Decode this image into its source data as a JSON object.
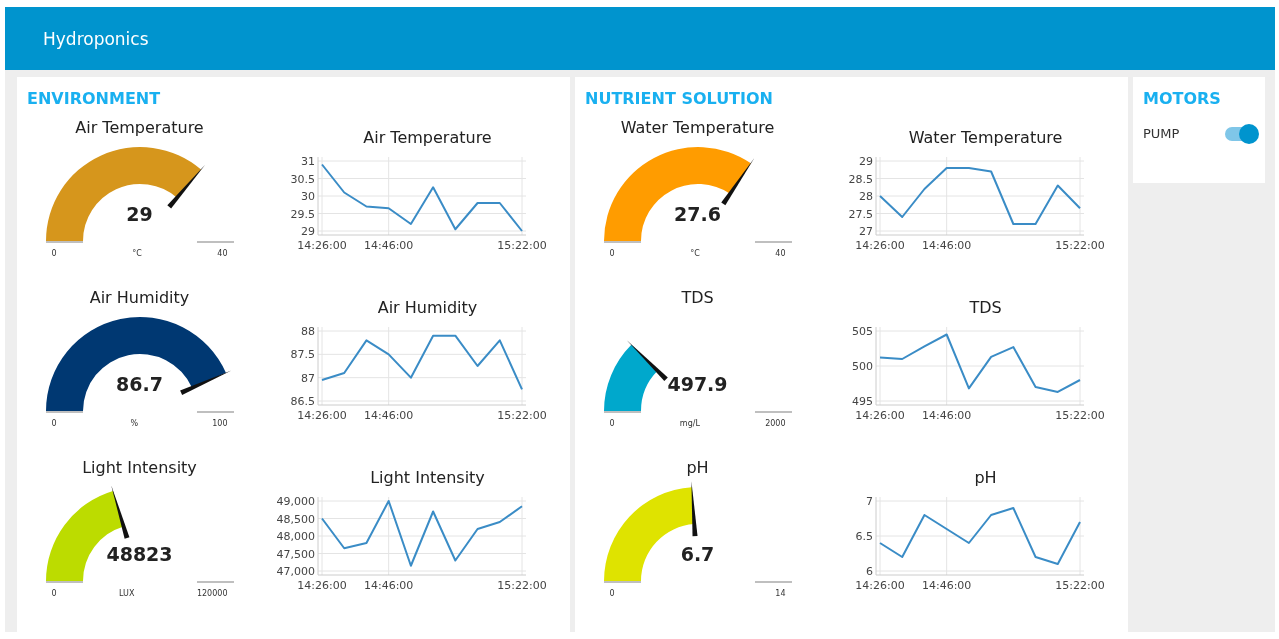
{
  "header": {
    "title": "Hydroponics"
  },
  "groups": [
    {
      "title": "ENVIRONMENT",
      "widgets": [
        {
          "gauge": {
            "title": "Air Temperature",
            "value": "29",
            "unit": "°C",
            "min": "0",
            "max": "40",
            "level": 0.725,
            "color": "#d6961c"
          },
          "chart_data": {
            "type": "line",
            "title": "Air Temperature",
            "grid": true,
            "categories": [
              "14:26:00",
              null,
              null,
              "14:46:00",
              null,
              null,
              null,
              null,
              null,
              "15:22:00"
            ],
            "series": [
              {
                "color": "#3a8cc6",
                "values": [
                  30.9,
                  30.1,
                  29.7,
                  29.65,
                  29.2,
                  30.25,
                  29.05,
                  29.8,
                  29.8,
                  29.0
                ]
              }
            ],
            "ylim": [
              29,
              31
            ],
            "yticks": [
              29,
              29.5,
              30,
              30.5,
              31
            ]
          }
        },
        {
          "gauge": {
            "title": "Air Humidity",
            "value": "86.7",
            "unit": "%",
            "min": "0",
            "max": "100",
            "level": 0.867,
            "color": "#003872"
          },
          "chart_data": {
            "type": "line",
            "title": "Air Humidity",
            "grid": true,
            "categories": [
              "14:26:00",
              null,
              null,
              "14:46:00",
              null,
              null,
              null,
              null,
              null,
              "15:22:00"
            ],
            "series": [
              {
                "color": "#3a8cc6",
                "values": [
                  86.95,
                  87.1,
                  87.8,
                  87.5,
                  87.0,
                  87.9,
                  87.9,
                  87.25,
                  87.8,
                  86.75
                ]
              }
            ],
            "ylim": [
              86.5,
              88
            ],
            "yticks": [
              86.5,
              87,
              87.5,
              88
            ]
          }
        },
        {
          "gauge": {
            "title": "Light Intensity",
            "value": "48823",
            "unit": "LUX",
            "min": "0",
            "max": "120000",
            "level": 0.407,
            "color": "#bcdc00"
          },
          "chart_data": {
            "type": "line",
            "title": "Light Intensity",
            "grid": true,
            "categories": [
              "14:26:00",
              null,
              null,
              "14:46:00",
              null,
              null,
              null,
              null,
              null,
              "15:22:00"
            ],
            "series": [
              {
                "color": "#3a8cc6",
                "values": [
                  48500,
                  47650,
                  47800,
                  49000,
                  47150,
                  48700,
                  47300,
                  48200,
                  48400,
                  48850
                ]
              }
            ],
            "ylim": [
              47000,
              49000
            ],
            "yticks": [
              {
                "value": 47000,
                "label": "47,000"
              },
              {
                "value": 47500,
                "label": "47,500"
              },
              {
                "value": 48000,
                "label": "48,000"
              },
              {
                "value": 48500,
                "label": "48,500"
              },
              {
                "value": 49000,
                "label": "49,000"
              }
            ]
          }
        }
      ]
    },
    {
      "title": "NUTRIENT SOLUTION",
      "widgets": [
        {
          "gauge": {
            "title": "Water Temperature",
            "value": "27.6",
            "unit": "°C",
            "min": "0",
            "max": "40",
            "level": 0.69,
            "color": "#ff9c00"
          },
          "chart_data": {
            "type": "line",
            "title": "Water Temperature",
            "grid": true,
            "categories": [
              "14:26:00",
              null,
              null,
              "14:46:00",
              null,
              null,
              null,
              null,
              null,
              "15:22:00"
            ],
            "series": [
              {
                "color": "#3a8cc6",
                "values": [
                  28.0,
                  27.4,
                  28.2,
                  28.8,
                  28.8,
                  28.7,
                  27.2,
                  27.2,
                  28.3,
                  27.65
                ]
              }
            ],
            "ylim": [
              27,
              29
            ],
            "yticks": [
              27,
              27.5,
              28,
              28.5,
              29
            ]
          }
        },
        {
          "gauge": {
            "title": "TDS",
            "value": "497.9",
            "unit": "mg/L",
            "min": "0",
            "max": "2000",
            "level": 0.249,
            "color": "#00a8cc"
          },
          "chart_data": {
            "type": "line",
            "title": "TDS",
            "grid": true,
            "categories": [
              "14:26:00",
              null,
              null,
              "14:46:00",
              null,
              null,
              null,
              null,
              null,
              "15:22:00"
            ],
            "series": [
              {
                "color": "#3a8cc6",
                "values": [
                  501.2,
                  501,
                  502.8,
                  504.5,
                  496.8,
                  501.3,
                  502.7,
                  497,
                  496.3,
                  498
                ]
              }
            ],
            "ylim": [
              495,
              505
            ],
            "yticks": [
              495,
              500,
              505
            ]
          }
        },
        {
          "gauge": {
            "title": "pH",
            "value": "6.7",
            "min": "0",
            "max": "14",
            "level": 0.479,
            "color": "#dfe300"
          },
          "chart_data": {
            "type": "line",
            "title": "pH",
            "grid": true,
            "categories": [
              "14:26:00",
              null,
              null,
              "14:46:00",
              null,
              null,
              null,
              null,
              null,
              "15:22:00"
            ],
            "series": [
              {
                "color": "#3a8cc6",
                "values": [
                  6.4,
                  6.2,
                  6.8,
                  6.6,
                  6.4,
                  6.8,
                  6.9,
                  6.2,
                  6.1,
                  6.7
                ]
              }
            ],
            "ylim": [
              6,
              7
            ],
            "yticks": [
              6,
              6.5,
              7
            ]
          }
        }
      ]
    }
  ],
  "motors": {
    "title": "MOTORS",
    "items": [
      {
        "label": "PUMP",
        "on": true
      }
    ]
  }
}
